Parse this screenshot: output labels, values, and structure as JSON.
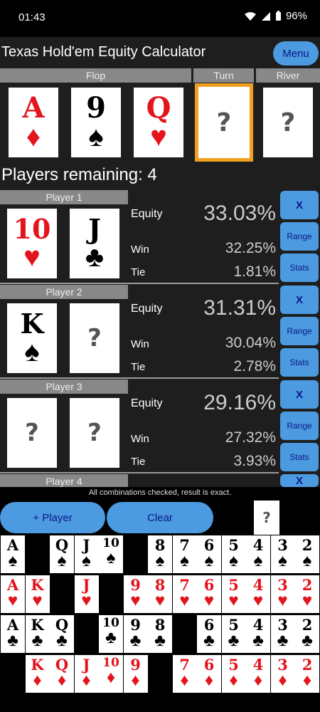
{
  "status": {
    "time": "01:43",
    "battery": "96%"
  },
  "app": {
    "title": "Texas Hold'em Equity Calculator",
    "menu_label": "Menu",
    "sections": {
      "flop": "Flop",
      "turn": "Turn",
      "river": "River"
    },
    "board": [
      {
        "rank": "A",
        "suit": "♦",
        "color": "red"
      },
      {
        "rank": "9",
        "suit": "♠",
        "color": "blk"
      },
      {
        "rank": "Q",
        "suit": "♥",
        "color": "red"
      },
      {
        "rank": "?",
        "suit": "",
        "color": "unknown"
      },
      {
        "rank": "?",
        "suit": "",
        "color": "unknown"
      }
    ],
    "players_remaining": "Players remaining: 4",
    "labels": {
      "equity": "Equity",
      "win": "Win",
      "tie": "Tie",
      "x": "X",
      "range": "Range",
      "stats": "Stats"
    },
    "players": [
      {
        "name": "Player 1",
        "equity": "33.03%",
        "win": "32.25%",
        "tie": "1.81%",
        "cards": [
          {
            "rank": "10",
            "suit": "♥",
            "color": "red"
          },
          {
            "rank": "J",
            "suit": "♣",
            "color": "blk"
          }
        ]
      },
      {
        "name": "Player 2",
        "equity": "31.31%",
        "win": "30.04%",
        "tie": "2.78%",
        "cards": [
          {
            "rank": "K",
            "suit": "♠",
            "color": "blk"
          },
          {
            "rank": "?",
            "suit": "",
            "color": "unknown"
          }
        ]
      },
      {
        "name": "Player 3",
        "equity": "29.16%",
        "win": "27.32%",
        "tie": "3.93%",
        "cards": [
          {
            "rank": "?",
            "suit": "",
            "color": "unknown"
          },
          {
            "rank": "?",
            "suit": "",
            "color": "unknown"
          }
        ]
      },
      {
        "name": "Player 4"
      }
    ],
    "exact_note": "All combinations checked, result is exact.",
    "add_player_label": "+ Player",
    "clear_label": "Clear",
    "selected_card": "?",
    "deck_ranks": [
      "A",
      "K",
      "Q",
      "J",
      "10",
      "9",
      "8",
      "7",
      "6",
      "5",
      "4",
      "3",
      "2"
    ],
    "deck_rows": [
      {
        "suit": "♠",
        "color": "blk",
        "available": [
          true,
          false,
          true,
          true,
          true,
          false,
          true,
          true,
          true,
          true,
          true,
          true,
          true
        ]
      },
      {
        "suit": "♥",
        "color": "red",
        "available": [
          true,
          true,
          false,
          true,
          false,
          true,
          true,
          true,
          true,
          true,
          true,
          true,
          true
        ]
      },
      {
        "suit": "♣",
        "color": "blk",
        "available": [
          true,
          true,
          true,
          false,
          true,
          true,
          true,
          false,
          true,
          true,
          true,
          true,
          true
        ]
      },
      {
        "suit": "♦",
        "color": "red",
        "available": [
          false,
          true,
          true,
          true,
          true,
          true,
          false,
          true,
          true,
          true,
          true,
          true,
          true
        ]
      }
    ],
    "colors": {
      "accent": "#4c9ae0",
      "highlight": "#f0a020",
      "red_suit": "#e3141d"
    }
  }
}
